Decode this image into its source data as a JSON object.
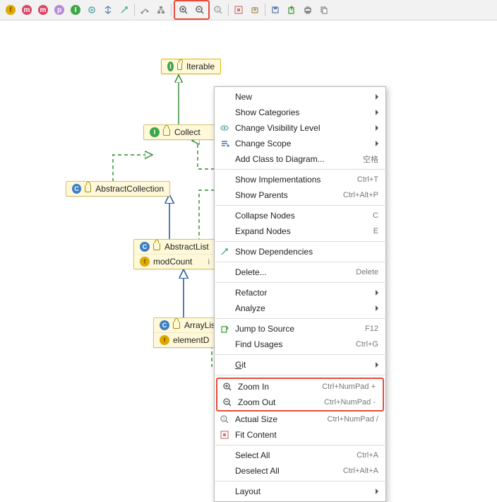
{
  "nodes": {
    "iterable": {
      "label": "Iterable",
      "kind": "I"
    },
    "collection": {
      "label": "Collect",
      "kind": "I"
    },
    "abstractCollection": {
      "label": "AbstractCollection",
      "kind": "C"
    },
    "abstractList_class": {
      "label": "AbstractList",
      "kind": "C"
    },
    "abstractList_field": {
      "label": "modCount",
      "kind": "f"
    },
    "arrayList_class": {
      "label": "ArrayList",
      "kind": "C"
    },
    "arrayList_field": {
      "label": "elementD",
      "kind": "f"
    }
  },
  "toolbar_icons": [
    "f",
    "m",
    "m",
    "p",
    "I"
  ],
  "ctx": [
    {
      "t": "New",
      "sub": true
    },
    {
      "t": "Show Categories",
      "sub": true
    },
    {
      "t": "Change Visibility Level",
      "sub": true,
      "ico": "vis"
    },
    {
      "t": "Change Scope",
      "sub": true,
      "ico": "scope"
    },
    {
      "t": "Add Class to Diagram...",
      "sc": "空格"
    },
    {
      "sep": true
    },
    {
      "t": "Show Implementations",
      "sc": "Ctrl+T"
    },
    {
      "t": "Show Parents",
      "sc": "Ctrl+Alt+P"
    },
    {
      "sep": true
    },
    {
      "t": "Collapse Nodes",
      "sc": "C"
    },
    {
      "t": "Expand Nodes",
      "sc": "E"
    },
    {
      "sep": true
    },
    {
      "t": "Show Dependencies",
      "ico": "dep"
    },
    {
      "sep": true
    },
    {
      "t": "Delete...",
      "sc": "Delete"
    },
    {
      "sep": true
    },
    {
      "t": "Refactor",
      "sub": true
    },
    {
      "t": "Analyze",
      "sub": true
    },
    {
      "sep": true
    },
    {
      "t": "Jump to Source",
      "sc": "F12",
      "ico": "jump"
    },
    {
      "t": "Find Usages",
      "sc": "Ctrl+G"
    },
    {
      "sep": true
    },
    {
      "t": "Git",
      "sub": true,
      "u": "G"
    },
    {
      "sep": true
    },
    {
      "hl_start": true
    },
    {
      "t": "Zoom In",
      "sc": "Ctrl+NumPad +",
      "ico": "zin"
    },
    {
      "t": "Zoom Out",
      "sc": "Ctrl+NumPad -",
      "ico": "zout"
    },
    {
      "hl_end": true
    },
    {
      "t": "Actual Size",
      "sc": "Ctrl+NumPad /",
      "ico": "act"
    },
    {
      "t": "Fit Content",
      "ico": "fit"
    },
    {
      "sep": true
    },
    {
      "t": "Select All",
      "sc": "Ctrl+A"
    },
    {
      "t": "Deselect All",
      "sc": "Ctrl+Alt+A"
    },
    {
      "sep": true
    },
    {
      "t": "Layout",
      "sub": true
    }
  ]
}
